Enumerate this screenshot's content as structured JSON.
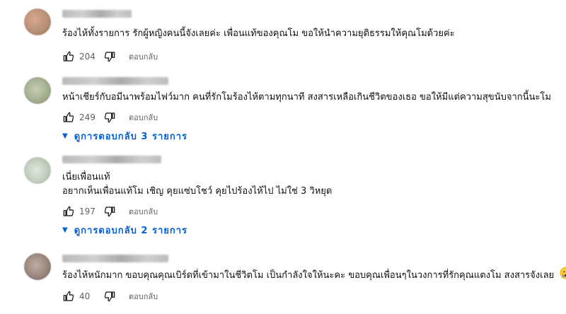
{
  "comments": [
    {
      "text_lines": [
        "ร้องไห้ทั้งรายการ รักผู้หญิงคนนี้จังเลยค่ะ เพื่อนแท้ของคุณโม ขอให้นำความยุติธรรมให้คุณโมด้วยค่ะ"
      ],
      "likes": "204",
      "reply_label": "ตอบกลับ",
      "avatar_color": "#b98f78"
    },
    {
      "text_lines": [
        "หน้าเชียร์กับอมีนาพร้อมไฟว์มาก คนที่รักโมร้องไห้ตามทุกนาที สงสารเหลือเกินชีวิตของเธอ ขอให้มีแต่ความสุขนับจากนี้นะโม"
      ],
      "likes": "249",
      "reply_label": "ตอบกลับ",
      "view_replies": "ดูการตอบกลับ 3 รายการ",
      "avatar_color": "#a7b193"
    },
    {
      "text_lines": [
        "เนี่ยเพื่อนแท้",
        "อยากเห็นเพื่อนแท้โม เชิญ คุยแซ่บโชว์ คุยไปร้องไห้ไป ไม่ใช่ 3 วิหยุด"
      ],
      "likes": "197",
      "reply_label": "ตอบกลับ",
      "view_replies": "ดูการตอบกลับ 2 รายการ",
      "avatar_color": "#c3d0c0"
    },
    {
      "text_lines": [
        "ร้องไห้หนักมาก ขอบคุณคุณเบิร์ดที่เข้ามาในชีวิตโม เป็นกำลังใจให้นะคะ ขอบคุณเพื่อนๆในวงการที่รักคุณแตงโม สงสารจังเลย"
      ],
      "likes": "40",
      "reply_label": "ตอบกลับ",
      "avatar_color": "#9d8a80"
    }
  ],
  "icons": {
    "like": "thumbs-up-icon",
    "dislike": "thumbs-down-icon",
    "expand": "caret-down-icon",
    "emoji1": "crying-face-emoji",
    "emoji2": "sparkling-heart-emoji"
  },
  "colors": {
    "link": "#065fd4",
    "meta": "#606060"
  }
}
